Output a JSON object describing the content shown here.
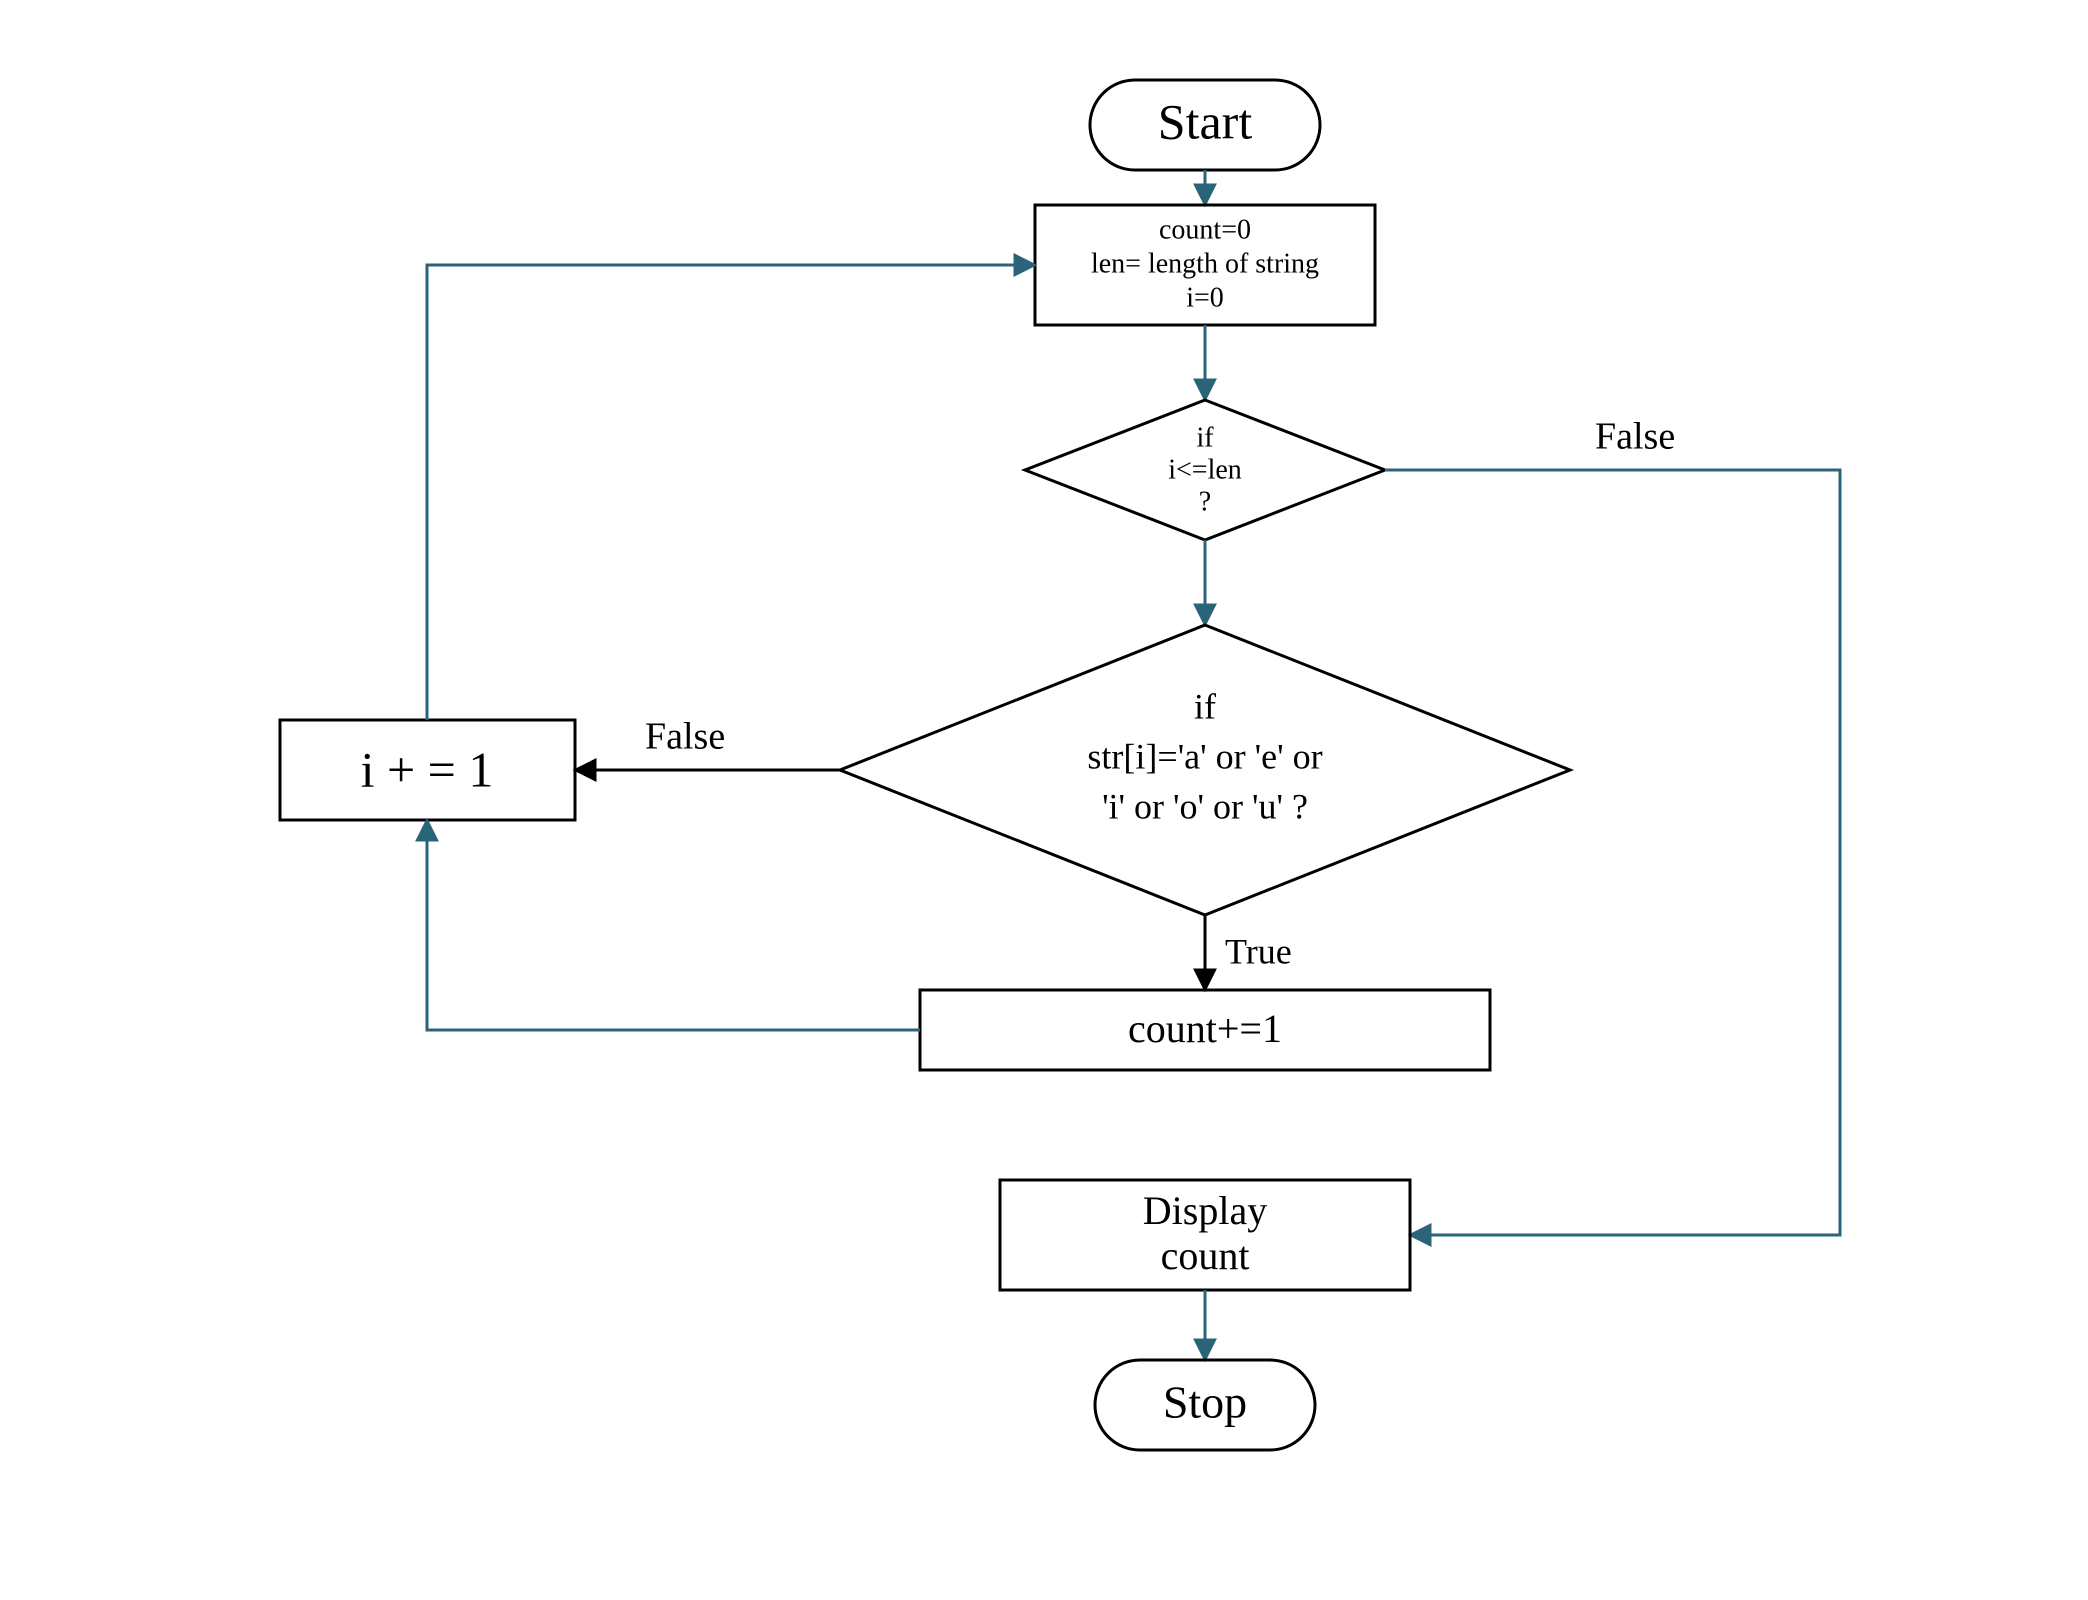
{
  "flowchart": {
    "nodes": {
      "start": {
        "label": "Start"
      },
      "init": {
        "line1": "count=0",
        "line2": "len= length of string",
        "line3": "i=0"
      },
      "decision_len": {
        "line1": "if",
        "line2": "i<=len",
        "line3": "?"
      },
      "decision_vowel": {
        "line1": "if",
        "line2": "str[i]='a' or 'e' or",
        "line3": "'i' or 'o' or 'u' ?"
      },
      "count_inc": {
        "label": "count+=1"
      },
      "i_inc": {
        "label": "i + = 1"
      },
      "display": {
        "line1": "Display",
        "line2": "count"
      },
      "stop": {
        "label": "Stop"
      }
    },
    "edge_labels": {
      "len_false": "False",
      "vowel_true": "True",
      "vowel_false": "False"
    },
    "colors": {
      "outline_black": "#000000",
      "arrow_teal": "#2a6478"
    }
  }
}
